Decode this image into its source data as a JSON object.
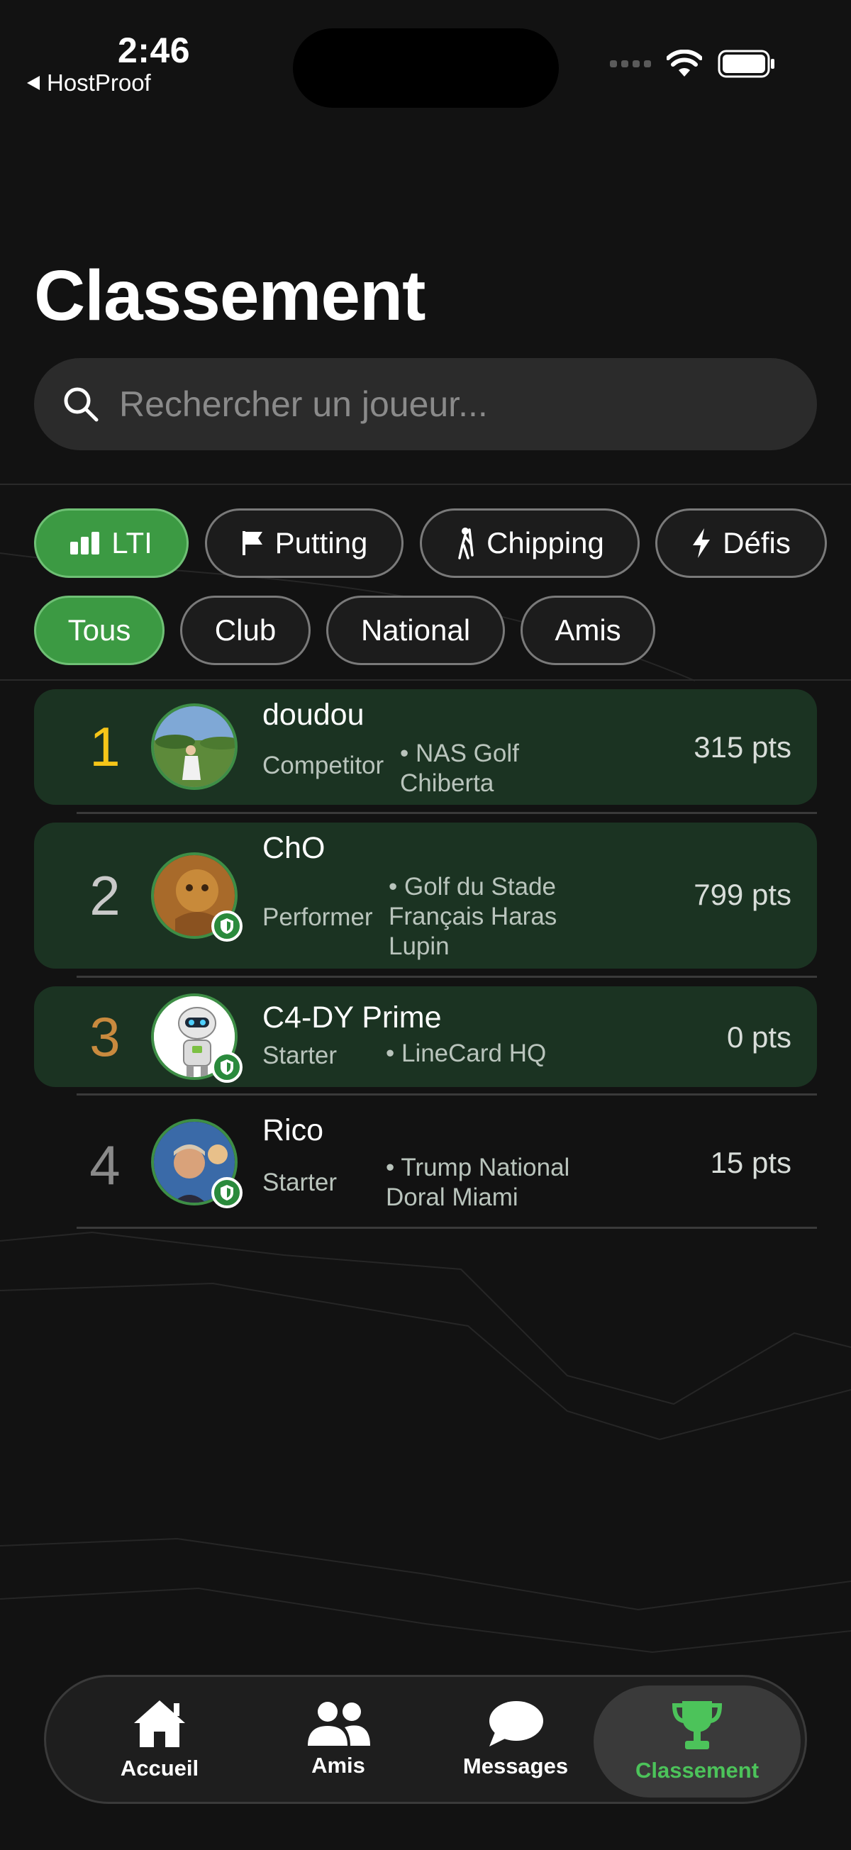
{
  "status_bar": {
    "time": "2:46",
    "back_app": "HostProof"
  },
  "header": {
    "title": "Classement"
  },
  "search": {
    "placeholder": "Rechercher un joueur..."
  },
  "category_tabs": [
    {
      "label": "LTI",
      "icon": "bar-chart-icon",
      "active": true
    },
    {
      "label": "Putting",
      "icon": "flag-icon",
      "active": false
    },
    {
      "label": "Chipping",
      "icon": "golfer-icon",
      "active": false
    },
    {
      "label": "Défis",
      "icon": "bolt-icon",
      "active": false
    }
  ],
  "scope_tabs": [
    {
      "label": "Tous",
      "active": true
    },
    {
      "label": "Club",
      "active": false
    },
    {
      "label": "National",
      "active": false
    },
    {
      "label": "Amis",
      "active": false
    }
  ],
  "leaderboard": [
    {
      "rank": "1",
      "name": "doudou",
      "level": "Competitor",
      "club_line1": "• NAS Golf",
      "club_line2": "Chiberta",
      "club_line3": "",
      "points": "315 pts",
      "rank_color": "#f5c518"
    },
    {
      "rank": "2",
      "name": "ChO",
      "level": "Performer",
      "club_line1": "• Golf du Stade",
      "club_line2": "Français Haras",
      "club_line3": "Lupin",
      "points": "799 pts",
      "rank_color": "#c9c9c9"
    },
    {
      "rank": "3",
      "name": "C4-DY Prime",
      "level": "Starter",
      "club_line1": "• LineCard HQ",
      "club_line2": "",
      "club_line3": "",
      "points": "0 pts",
      "rank_color": "#c98a3e"
    },
    {
      "rank": "4",
      "name": "Rico",
      "level": "Starter",
      "club_line1": "• Trump National",
      "club_line2": "Doral Miami",
      "club_line3": "",
      "points": "15 pts",
      "rank_color": "#8a8a8a"
    }
  ],
  "tab_bar": [
    {
      "label": "Accueil",
      "icon": "home-icon",
      "active": false
    },
    {
      "label": "Amis",
      "icon": "people-icon",
      "active": false
    },
    {
      "label": "Messages",
      "icon": "chat-bubble-icon",
      "active": false
    },
    {
      "label": "Classement",
      "icon": "trophy-icon",
      "active": true
    }
  ],
  "colors": {
    "accent_green": "#3c9a43",
    "active_tab_text": "#4cc35a",
    "row_highlight": "#1b3322"
  }
}
